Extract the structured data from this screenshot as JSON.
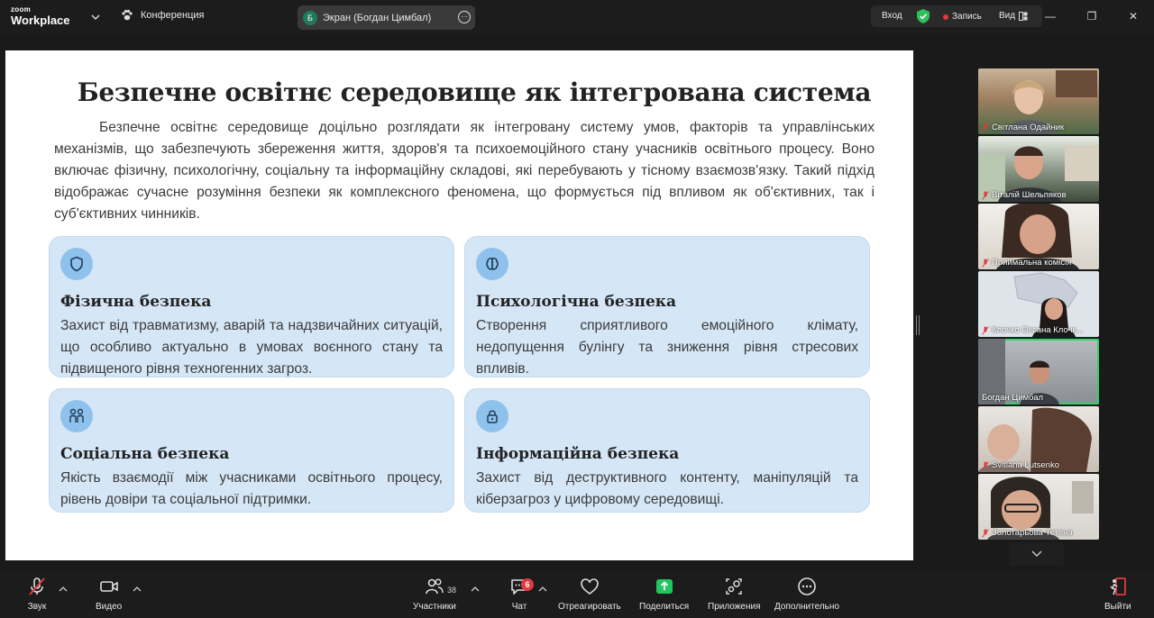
{
  "app": {
    "logo_small": "zoom",
    "logo_big": "Workplace",
    "meeting_label": "Конференция",
    "screen_share_label": "Экран (Богдан Цимбал)",
    "screen_share_initial": "Б",
    "signin_label": "Вход",
    "record_label": "Запись",
    "view_label": "Вид"
  },
  "slide": {
    "title": "Безпечне освітнє середовище як інтегрована система",
    "intro": "Безпечне освітнє середовище доцільно розглядати як інтегровану систему умов, факторів та управлінських механізмів, що забезпечують збереження життя, здоров'я та психоемоційного стану учасників освітнього процесу. Воно включає фізичну, психологічну, соціальну та інформаційну складові, які перебувають у тісному взаємозв'язку. Такий підхід відображає сучасне розуміння безпеки як комплексного феномена, що формується під впливом як об'єктивних, так і суб'єктивних чинників.",
    "cards": [
      {
        "title": "Фізична безпека",
        "text": "Захист від травматизму, аварій та надзвичайних ситуацій, що особливо актуально в умовах воєнного стану та підвищеного рівня техногенних загроз.",
        "icon": "shield-icon"
      },
      {
        "title": "Психологічна безпека",
        "text": "Створення сприятливого емоційного клімату, недопущення булінгу та зниження рівня стресових впливів.",
        "icon": "brain-icon"
      },
      {
        "title": "Соціальна безпека",
        "text": "Якість взаємодії між учасниками освітнього процесу, рівень довіри та соціальної підтримки.",
        "icon": "people-icon"
      },
      {
        "title": "Інформаційна безпека",
        "text": "Захист від деструктивного контенту, маніпуляцій та кіберзагроз у цифровому середовищі.",
        "icon": "lock-icon"
      }
    ]
  },
  "participants": [
    {
      "name": "Світлана Одайник",
      "muted": true
    },
    {
      "name": "Віталій Шельпяков",
      "muted": true
    },
    {
      "name": "Приймальна комісія",
      "muted": true
    },
    {
      "name": "Клочко Оксана Клочк...",
      "muted": true
    },
    {
      "name": "Богдан Цимбал",
      "muted": false,
      "active": true
    },
    {
      "name": "Svitlana Lutsenko",
      "muted": true
    },
    {
      "name": "Золотарьова Тетяна",
      "muted": true
    }
  ],
  "toolbar": {
    "audio": "Звук",
    "video": "Видео",
    "participants": "Участники",
    "participants_count": "38",
    "chat": "Чат",
    "chat_badge": "6",
    "react": "Отреагировать",
    "share": "Поделиться",
    "apps": "Приложения",
    "more": "Дополнительно",
    "leave": "Выйти"
  },
  "colors": {
    "accent_green": "#2fd36a",
    "share_green": "#22c55e",
    "muted_red": "#e0393e",
    "card_bg": "#d5e6f6",
    "icon_bg": "#8ec2ec"
  }
}
